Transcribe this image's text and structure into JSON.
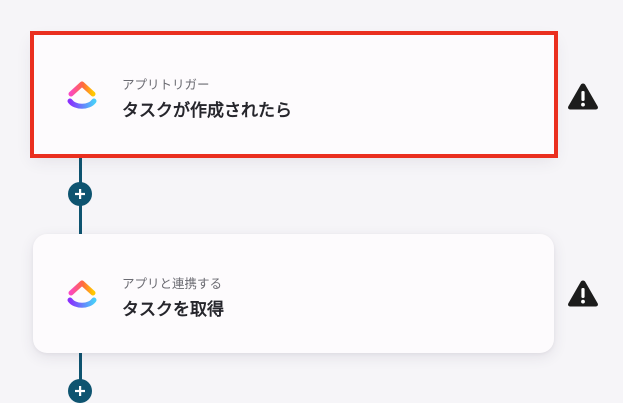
{
  "flow": {
    "steps": [
      {
        "label": "アプリトリガー",
        "title": "タスクが作成されたら",
        "app_icon": "clickup-logo",
        "status_icon": "warning-icon",
        "selected": true
      },
      {
        "label": "アプリと連携する",
        "title": "タスクを取得",
        "app_icon": "clickup-logo",
        "status_icon": "warning-icon",
        "selected": false
      }
    ],
    "add_step_icon": "plus-icon"
  },
  "colors": {
    "background": "#f6f5f8",
    "connector": "#0e5470",
    "selection_border": "#ea2f1f",
    "card_background": "#fdfbfd",
    "warning": "#1c1c1c",
    "title_text": "#26262c",
    "label_text": "#6b6b72"
  }
}
